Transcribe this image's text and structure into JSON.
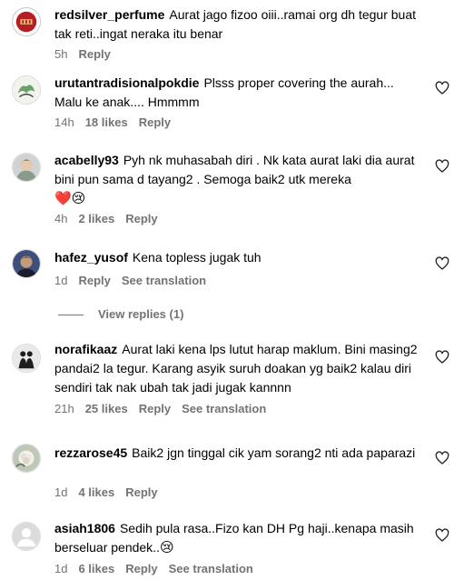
{
  "comments": [
    {
      "username": "redsilver_perfume",
      "text": "Aurat jago fizoo oiii..ramai org dh tegur buat tak reti..ingat neraka itu benar",
      "time": "5h",
      "likes": "",
      "reply": "Reply",
      "see_translation": ""
    },
    {
      "username": "urutantradisionalpokdie",
      "text": "Plsss proper covering the aurah... Malu ke anak.... Hmmmm",
      "time": "14h",
      "likes": "18 likes",
      "reply": "Reply",
      "see_translation": ""
    },
    {
      "username": "acabelly93",
      "text": "Pyh nk muhasabah diri . Nk kata aurat laki dia aurat bini pun sama d tayang2 . Semoga baik2 utk mereka",
      "emoji": "❤️😢",
      "time": "4h",
      "likes": "2 likes",
      "reply": "Reply",
      "see_translation": ""
    },
    {
      "username": "hafez_yusof",
      "text": "Kena topless jugak tuh",
      "time": "1d",
      "likes": "",
      "reply": "Reply",
      "see_translation": "See translation"
    },
    {
      "username": "norafikaaz",
      "text": "Aurat laki kena lps lutut harap maklum. Bini masing2 pandai2 la tegur. Karang asyik suruh doakan yg baik2 kalau diri sendiri tak nak ubah tak jadi jugak kannnn",
      "time": "21h",
      "likes": "25 likes",
      "reply": "Reply",
      "see_translation": "See translation"
    },
    {
      "username": "rezzarose45",
      "text": "Baik2 jgn tinggal cik yam sorang2 nti ada paparazi",
      "time": "1d",
      "likes": "4 likes",
      "reply": "Reply",
      "see_translation": ""
    },
    {
      "username": "asiah1806",
      "text": "Sedih pula rasa..Fizo kan DH Pg haji..kenapa masih berseluar pendek..",
      "emoji": "😢",
      "time": "1d",
      "likes": "6 likes",
      "reply": "Reply",
      "see_translation": "See translation"
    }
  ],
  "view_replies": "View replies (1)",
  "colors": {
    "secondary_text": "#737373",
    "primary_text": "#000000",
    "background": "#ffffff"
  },
  "icons": {
    "like": "heart-outline-icon"
  }
}
